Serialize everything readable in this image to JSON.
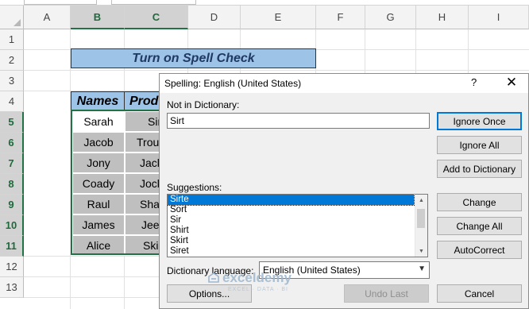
{
  "spreadsheet": {
    "columns": [
      "A",
      "B",
      "C",
      "D",
      "E",
      "F",
      "G",
      "H",
      "I"
    ],
    "rows": [
      "1",
      "2",
      "3",
      "4",
      "5",
      "6",
      "7",
      "8",
      "9",
      "10",
      "11",
      "12",
      "13"
    ],
    "title": "Turn on Spell Check",
    "headers": [
      "Names",
      "Prod"
    ],
    "names": [
      "Sarah",
      "Jacob",
      "Jony",
      "Coady",
      "Raul",
      "James",
      "Alice"
    ],
    "products_partial": [
      "Sir",
      "Trous",
      "Jack",
      "Jock",
      "Shar",
      "Jeer",
      "Skir"
    ]
  },
  "dialog": {
    "title": "Spelling: English (United States)",
    "help": "?",
    "close": "✕",
    "not_in_dictionary_label": "Not in Dictionary:",
    "not_in_dictionary_value": "Sirt",
    "suggestions_label": "Suggestions:",
    "suggestions": [
      "Sirte",
      "Sort",
      "Sir",
      "Shirt",
      "Skirt",
      "Siret"
    ],
    "selected_suggestion": "Sirte",
    "dictionary_language_label": "Dictionary language:",
    "dictionary_language_value": "English (United States)",
    "buttons": {
      "ignore_once": "Ignore Once",
      "ignore_all": "Ignore All",
      "add_to_dictionary": "Add to Dictionary",
      "change": "Change",
      "change_all": "Change All",
      "autocorrect": "AutoCorrect",
      "options": "Options...",
      "undo_last": "Undo Last",
      "cancel": "Cancel"
    }
  },
  "watermark": {
    "name": "exceldemy",
    "tagline": "EXCEL · DATA · BI"
  },
  "colors": {
    "header_blue": "#9dc3e6",
    "cell_gray": "#bfbfbf",
    "selection_green": "#217346",
    "highlight_blue": "#0078d7"
  }
}
